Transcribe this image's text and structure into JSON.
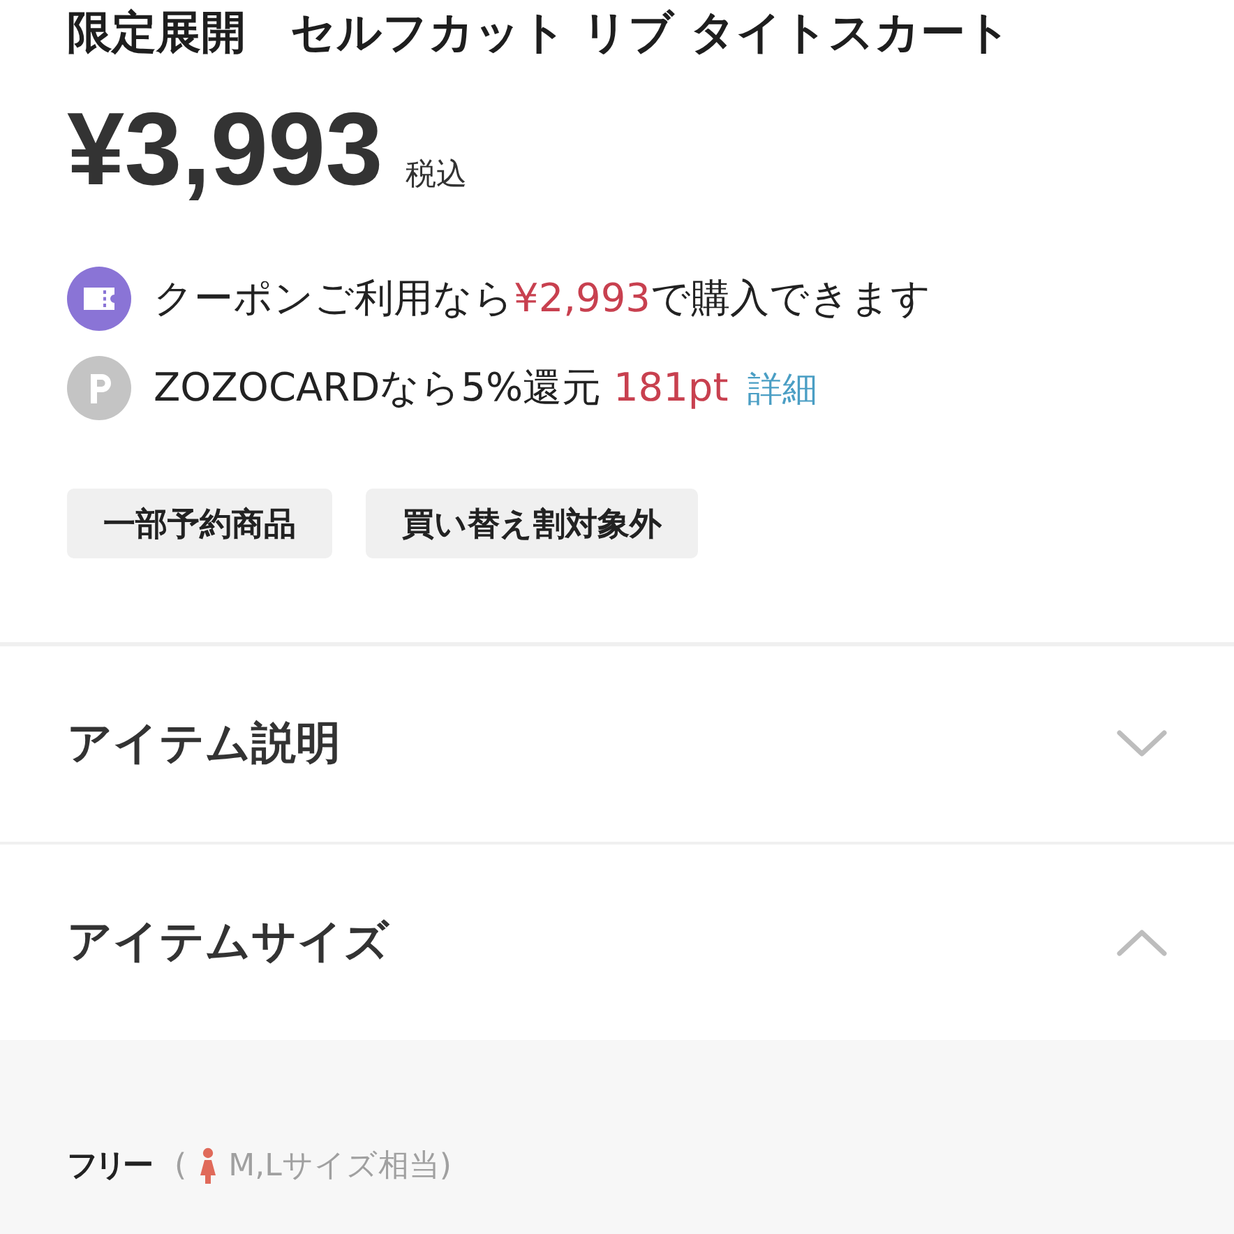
{
  "product": {
    "title": "限定展開　セルフカット リブ タイトスカート",
    "price": "¥3,993",
    "tax_note": "税込"
  },
  "offers": [
    {
      "kind": "coupon",
      "before": "クーポンご利用なら",
      "highlight": "¥2,993",
      "after": "で購入できます"
    },
    {
      "kind": "points",
      "before": "ZOZOCARDなら5%還元 ",
      "highlight": "181pt",
      "link": "詳細"
    }
  ],
  "tags": [
    "一部予約商品",
    "買い替え割対象外"
  ],
  "accordions": [
    {
      "label": "アイテム説明",
      "expanded": false
    },
    {
      "label": "アイテムサイズ",
      "expanded": true,
      "sizes": [
        {
          "size": "フリー",
          "note_open": "(",
          "note": "M,Lサイズ相当)"
        }
      ]
    }
  ]
}
